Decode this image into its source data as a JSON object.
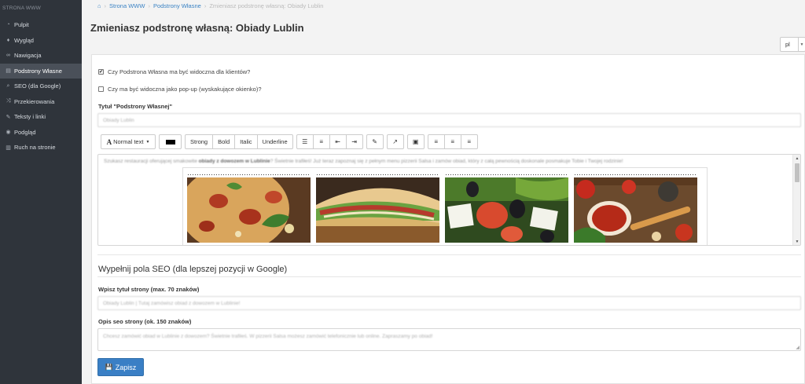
{
  "sidebar": {
    "brand": "STRONA WWW",
    "items": [
      {
        "label": "Pulpit",
        "icon": "dashboard-icon",
        "glyph": "◔"
      },
      {
        "label": "Wygląd",
        "icon": "tint-icon",
        "glyph": "♦"
      },
      {
        "label": "Nawigacja",
        "icon": "link-icon",
        "glyph": "∞"
      },
      {
        "label": "Podstrony Własne",
        "icon": "file-icon",
        "glyph": "▤"
      },
      {
        "label": "SEO (dla Google)",
        "icon": "search-icon",
        "glyph": "⌕"
      },
      {
        "label": "Przekierowania",
        "icon": "random-icon",
        "glyph": "⤨"
      },
      {
        "label": "Teksty i linki",
        "icon": "pencil-icon",
        "glyph": "✎"
      },
      {
        "label": "Podgląd",
        "icon": "eye-icon",
        "glyph": "◉"
      },
      {
        "label": "Ruch na stronie",
        "icon": "chart-icon",
        "glyph": "▥"
      }
    ]
  },
  "breadcrumb": {
    "home_glyph": "⌂",
    "items": [
      "Strona WWW",
      "Podstrony Własne"
    ],
    "current": "Zmieniasz podstronę własną: Obiady Lublin",
    "sep": "›"
  },
  "page_title": "Zmieniasz podstronę własną: Obiady Lublin",
  "language": {
    "selected": "pl",
    "caret": "▼"
  },
  "form": {
    "visible_checkbox": {
      "label": "Czy Podstrona Własna ma być widoczna dla klientów?",
      "checked": true,
      "mark": "✔"
    },
    "popup_checkbox": {
      "label": "Czy ma być widoczna jako pop-up (wyskakujące okienko)?",
      "checked": false,
      "mark": ""
    },
    "title_label": "Tytuł \"Podstrony Własnej\"",
    "title_value": "Obiady Lublin",
    "editor_text_pre": "Szukasz restauracji oferującej smakowite ",
    "editor_text_bold": "obiady z dowozem w Lublinie",
    "editor_text_post": "? Świetnie trafiłeś! Już teraz zapoznaj się z pełnym menu pizzerii Salsa i zamów obiad, który z całą pewnością doskonale posmakuje Tobie i Twojej rodzinie!",
    "seo_section_title": "Wypełnij pola SEO (dla lepszej pozycji w Google)",
    "seo_title_label": "Wpisz tytuł strony (max. 70 znaków)",
    "seo_title_value": "Obiady Lublin | Tutaj zamówisz obiad z dowozem w Lublinie!",
    "seo_desc_label": "Opis seo strony (ok. 150 znaków)",
    "seo_desc_value": "Chcesz zamówić obiad w Lublinie z dowozem? Świetnie trafiłeś. W pizzerii Salsa możesz zamówić telefonicznie lub online. Zapraszamy po obiad!",
    "save_label": "Zapisz",
    "save_glyph": "💾"
  },
  "toolbar": {
    "normal_text": "Normal text",
    "normal_glyph": "A",
    "strong": "Strong",
    "bold": "Bold",
    "italic": "Italic",
    "underline": "Underline",
    "icons": {
      "ul": "☰",
      "ol": "≡",
      "outdent": "⇤",
      "indent": "⇥",
      "link": "✎",
      "share": "↗",
      "image": "▣",
      "align_left": "≡",
      "align_center": "≡",
      "align_right": "≡"
    }
  },
  "gallery": [
    {
      "name": "pizza-image"
    },
    {
      "name": "tortilla-wrap-image"
    },
    {
      "name": "greek-salad-image"
    },
    {
      "name": "tomato-spoon-image"
    }
  ]
}
